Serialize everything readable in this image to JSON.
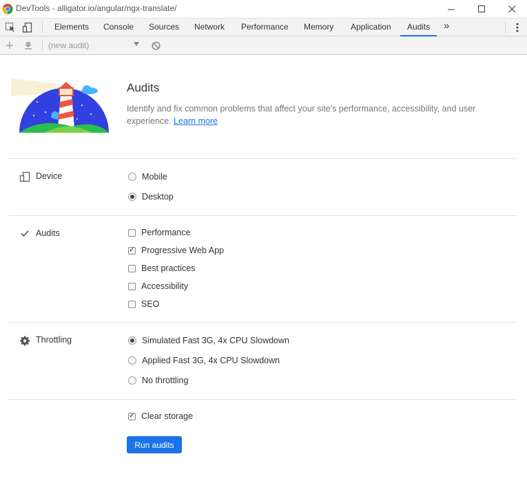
{
  "window": {
    "title": "DevTools - alligator.io/angular/ngx-translate/",
    "minimize": "—",
    "maximize": "☐",
    "close": "✕"
  },
  "tabs": [
    {
      "label": "Elements"
    },
    {
      "label": "Console"
    },
    {
      "label": "Sources"
    },
    {
      "label": "Network"
    },
    {
      "label": "Performance"
    },
    {
      "label": "Memory"
    },
    {
      "label": "Application"
    },
    {
      "label": "Audits",
      "active": true
    }
  ],
  "toolbar": {
    "audit_select": "(new audit)"
  },
  "header": {
    "title": "Audits",
    "description": "Identify and fix common problems that affect your site's performance, accessibility, and user experience.",
    "learn_more": "Learn more"
  },
  "device": {
    "label": "Device",
    "options": [
      {
        "label": "Mobile",
        "checked": false
      },
      {
        "label": "Desktop",
        "checked": true
      }
    ]
  },
  "audits": {
    "label": "Audits",
    "options": [
      {
        "label": "Performance",
        "checked": false
      },
      {
        "label": "Progressive Web App",
        "checked": true
      },
      {
        "label": "Best practices",
        "checked": false
      },
      {
        "label": "Accessibility",
        "checked": false
      },
      {
        "label": "SEO",
        "checked": false
      }
    ]
  },
  "throttling": {
    "label": "Throttling",
    "options": [
      {
        "label": "Simulated Fast 3G, 4x CPU Slowdown",
        "checked": true
      },
      {
        "label": "Applied Fast 3G, 4x CPU Slowdown",
        "checked": false
      },
      {
        "label": "No throttling",
        "checked": false
      }
    ]
  },
  "clear_storage": {
    "label": "Clear storage",
    "checked": true
  },
  "run_button": "Run audits",
  "colors": {
    "accent": "#1a73e8",
    "logo_sky": "#3340e0",
    "logo_grass": "#2bbd4f"
  }
}
